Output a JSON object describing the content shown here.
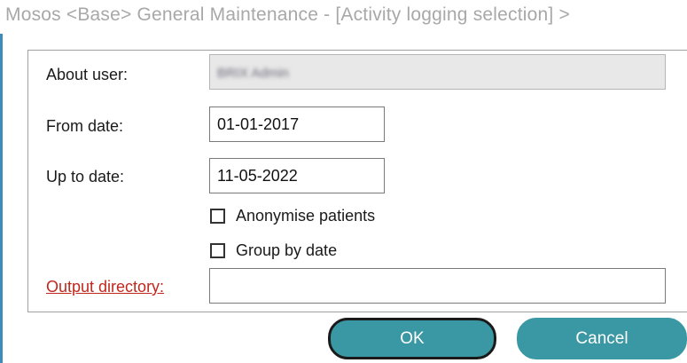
{
  "window": {
    "title": "Mosos <Base> General Maintenance - [Activity logging selection] >"
  },
  "form": {
    "about_user_label": "About user:",
    "about_user_value": "BRIX Admin",
    "from_date_label": "From date:",
    "from_date_value": "01-01-2017",
    "up_to_date_label": "Up to date:",
    "up_to_date_value": "11-05-2022",
    "anonymise_label": "Anonymise patients",
    "anonymise_checked": false,
    "group_by_date_label": "Group by date",
    "group_by_date_checked": false,
    "output_directory_label": "Output directory:",
    "output_directory_value": ""
  },
  "buttons": {
    "ok_label": "OK",
    "cancel_label": "Cancel"
  },
  "colors": {
    "accent": "#3a97a4",
    "link": "#c0281e",
    "window_border": "#3c8dbc"
  }
}
